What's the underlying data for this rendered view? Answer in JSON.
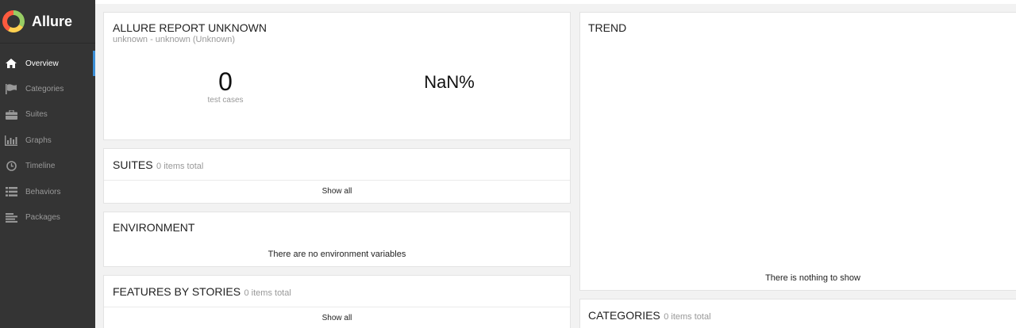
{
  "app": {
    "name": "Allure"
  },
  "sidebar": {
    "items": [
      {
        "label": "Overview",
        "icon": "home-icon",
        "active": true
      },
      {
        "label": "Categories",
        "icon": "flag-icon"
      },
      {
        "label": "Suites",
        "icon": "briefcase-icon"
      },
      {
        "label": "Graphs",
        "icon": "bar-chart-icon"
      },
      {
        "label": "Timeline",
        "icon": "clock-icon"
      },
      {
        "label": "Behaviors",
        "icon": "list-icon"
      },
      {
        "label": "Packages",
        "icon": "align-left-icon"
      }
    ]
  },
  "summary": {
    "title": "ALLURE REPORT UNKNOWN",
    "subtitle": "unknown - unknown (Unknown)",
    "count": "0",
    "count_label": "test cases",
    "percent": "NaN%"
  },
  "suites": {
    "title": "SUITES",
    "total": "0 items total",
    "show_all": "Show all"
  },
  "environment": {
    "title": "ENVIRONMENT",
    "empty": "There are no environment variables"
  },
  "features": {
    "title": "FEATURES BY STORIES",
    "total": "0 items total",
    "show_all": "Show all"
  },
  "trend": {
    "title": "TREND",
    "empty": "There is nothing to show"
  },
  "categories": {
    "title": "CATEGORIES",
    "total": "0 items total"
  },
  "colors": {
    "sidebar_bg": "#343434",
    "active_accent": "#3b8ed6",
    "logo_green": "#97cc64",
    "logo_orange": "#fd5a3e",
    "logo_yellow": "#ffd050"
  }
}
